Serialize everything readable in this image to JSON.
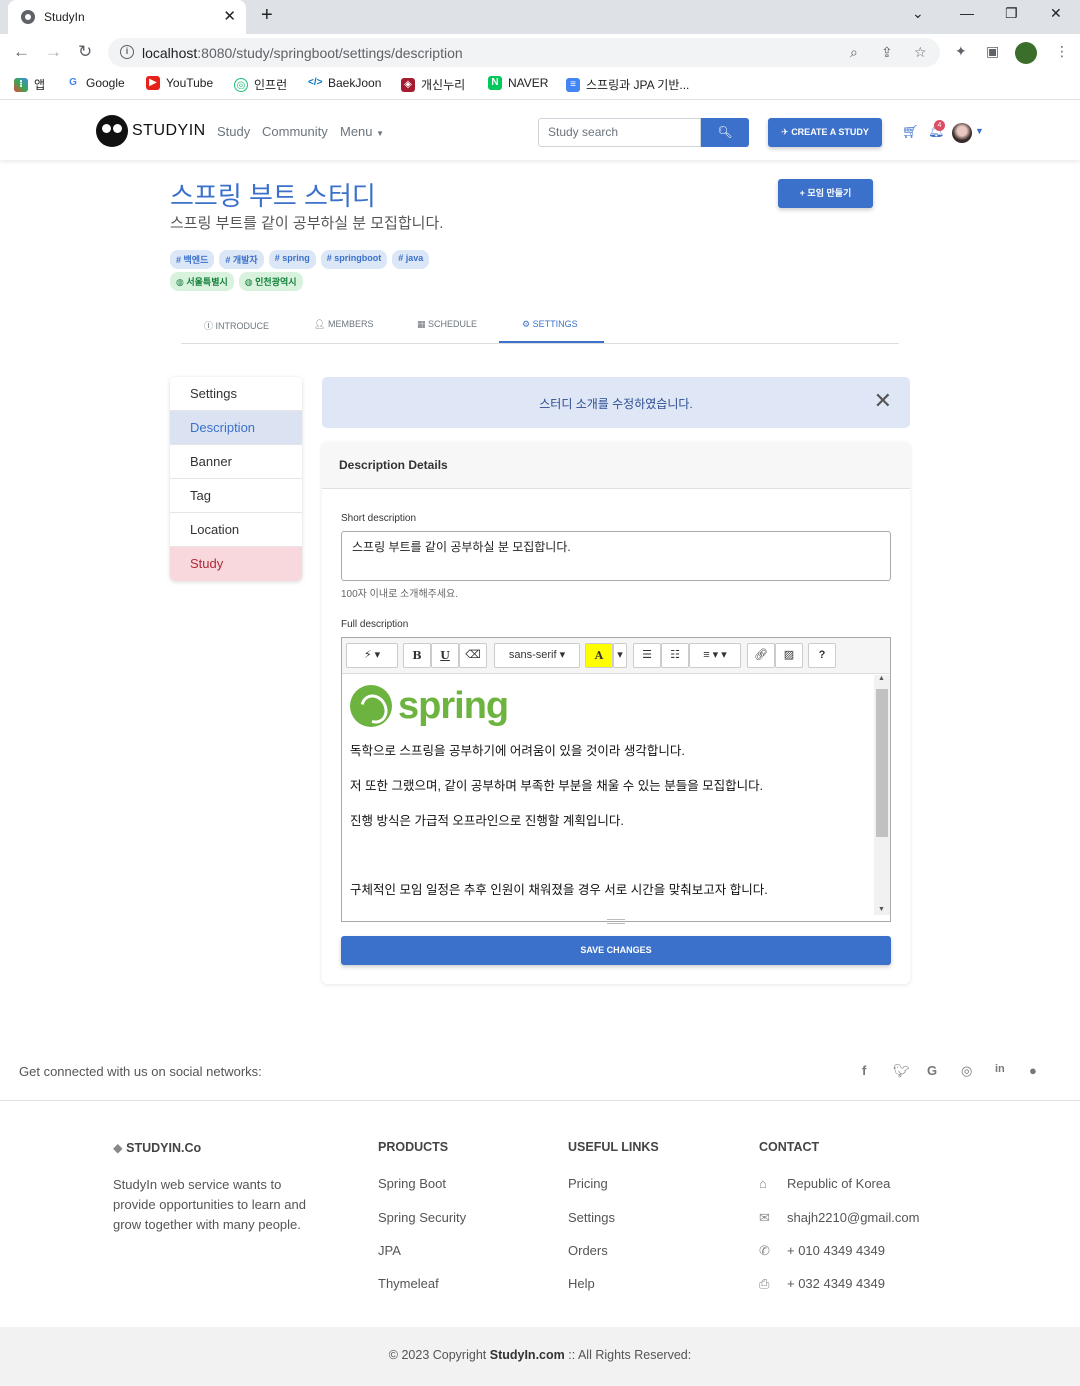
{
  "browser": {
    "tab_title": "StudyIn",
    "url_host": "localhost",
    "url_rest": ":8080/study/springboot/settings/description",
    "bookmarks": [
      "앱",
      "Google",
      "YouTube",
      "인프런",
      "BaekJoon",
      "개신누리",
      "NAVER",
      "스프링과 JPA 기반..."
    ]
  },
  "nav": {
    "brand": "STUDYIN",
    "links": [
      "Study",
      "Community",
      "Menu"
    ],
    "search_placeholder": "Study search",
    "create_label": "CREATE A STUDY",
    "notification_count": "4"
  },
  "study": {
    "title": "스프링 부트 스터디",
    "subtitle": "스프링 부트를 같이 공부하실 분 모집합니다.",
    "new_group_label": "+ 모임 만들기",
    "tags": [
      "백엔드",
      "개발자",
      "spring",
      "springboot",
      "java"
    ],
    "locations": [
      "서울특별시",
      "인천광역시"
    ],
    "tabs": [
      "INTRODUCE",
      "MEMBERS",
      "SCHEDULE",
      "SETTINGS"
    ]
  },
  "sidebar": {
    "items": [
      "Settings",
      "Description",
      "Banner",
      "Tag",
      "Location",
      "Study"
    ],
    "active": "Description"
  },
  "alert": {
    "message": "스터디 소개를 수정하였습니다."
  },
  "form": {
    "card_title": "Description Details",
    "short_label": "Short description",
    "short_value": "스프링 부트를 같이 공부하실 분 모집합니다.",
    "short_help": "100자 이내로 소개해주세요.",
    "full_label": "Full description",
    "font_name": "sans-serif",
    "content": {
      "logo": "spring",
      "lines": [
        "독학으로 스프링을 공부하기에 어려움이 있을 것이라 생각합니다.",
        "저 또한 그랬으며, 같이 공부하며 부족한 부분을 채울 수 있는 분들을 모집합니다.",
        "진행 방식은 가급적 오프라인으로 진행할 계획입니다.",
        "구체적인 모임 일정은 추후 인원이 채워졌을 경우 서로 시간을 맞춰보고자 합니다."
      ]
    },
    "save_label": "SAVE CHANGES"
  },
  "footer": {
    "social_text": "Get connected with us on social networks:",
    "brand_head": "STUDYIN.Co",
    "brand_text": "StudyIn web service wants to provide opportunities to learn and grow together with many people.",
    "products_head": "PRODUCTS",
    "products": [
      "Spring Boot",
      "Spring Security",
      "JPA",
      "Thymeleaf"
    ],
    "links_head": "USEFUL LINKS",
    "links": [
      "Pricing",
      "Settings",
      "Orders",
      "Help"
    ],
    "contact_head": "CONTACT",
    "contact": [
      "Republic of Korea",
      "shajh2210@gmail.com",
      "+ 010 4349 4349",
      "+ 032 4349 4349"
    ],
    "copyright_pre": "© 2023 Copyright",
    "copyright_brand": "StudyIn.com",
    "copyright_post": ":: All Rights Reserved:"
  }
}
